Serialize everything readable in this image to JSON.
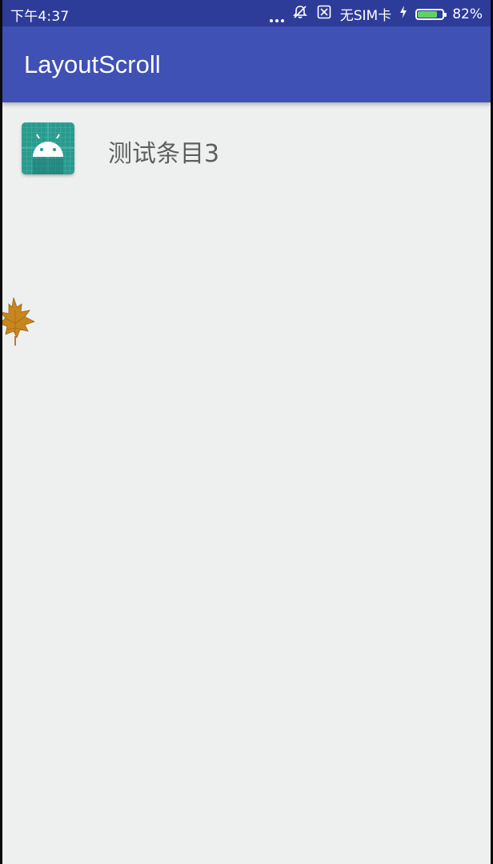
{
  "status_bar": {
    "time": "下午4:37",
    "sim_status": "无SIM卡",
    "battery_percent": "82%",
    "battery_level": 0.82,
    "icons": [
      "more-dots-icon",
      "mute-notification-icon",
      "no-sim-icon",
      "charging-icon",
      "battery-icon"
    ]
  },
  "app_bar": {
    "title": "LayoutScroll"
  },
  "list": {
    "items": [
      {
        "icon": "android-launcher-icon",
        "label": "测试条目3"
      }
    ]
  },
  "decor": {
    "leaf_icon": "maple-leaf-icon"
  },
  "colors": {
    "status_bar": "#2e3c99",
    "app_bar": "#3f51b5",
    "background": "#eef0f0",
    "icon_bg": "#2a9a8e",
    "battery": "#5fd35f"
  }
}
